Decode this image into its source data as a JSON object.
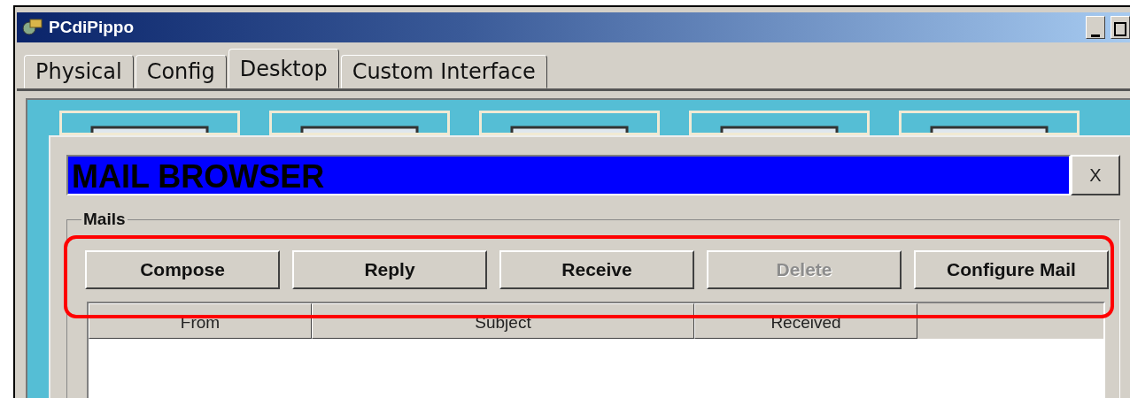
{
  "window": {
    "title": "PCdiPippo"
  },
  "tabs": [
    {
      "label": "Physical",
      "selected": false
    },
    {
      "label": "Config",
      "selected": false
    },
    {
      "label": "Desktop",
      "selected": true
    },
    {
      "label": "Custom Interface",
      "selected": false
    }
  ],
  "mail_browser": {
    "title": "MAIL BROWSER",
    "close": "X",
    "group_label": "Mails",
    "buttons": [
      {
        "label": "Compose",
        "disabled": false
      },
      {
        "label": "Reply",
        "disabled": false
      },
      {
        "label": "Receive",
        "disabled": false
      },
      {
        "label": "Delete",
        "disabled": true
      },
      {
        "label": "Configure Mail",
        "disabled": false
      }
    ],
    "table": {
      "columns": [
        "From",
        "Subject",
        "Received"
      ]
    }
  }
}
